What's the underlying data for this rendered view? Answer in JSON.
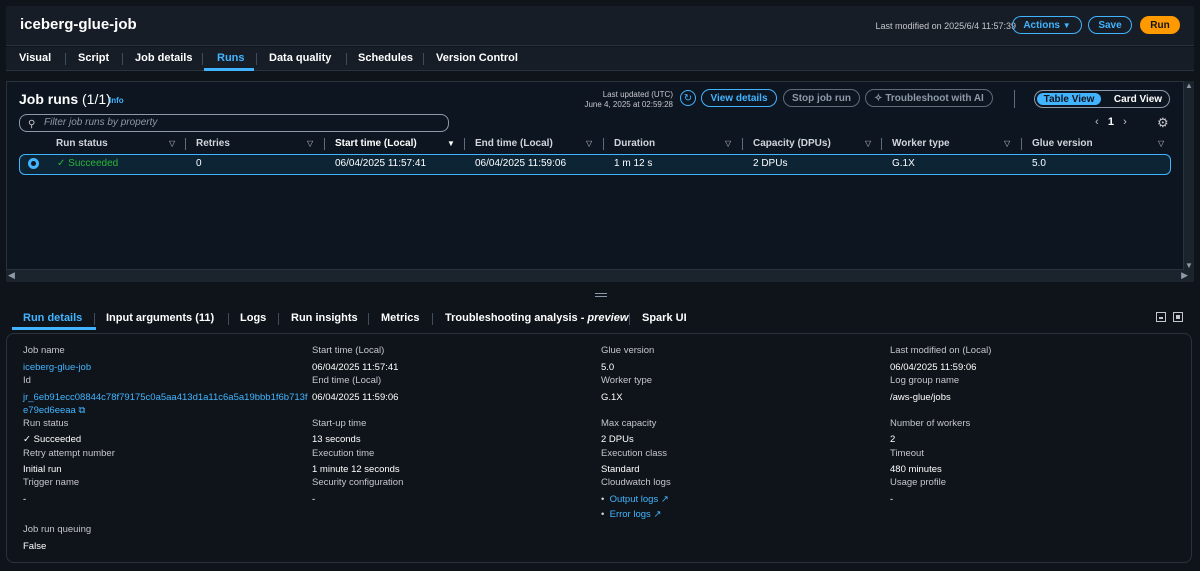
{
  "header": {
    "title": "iceberg-glue-job",
    "last_modified": "Last modified on 2025/6/4 11:57:39",
    "actions": "Actions",
    "save": "Save",
    "run": "Run"
  },
  "tabs": [
    "Visual",
    "Script",
    "Job details",
    "Runs",
    "Data quality",
    "Schedules",
    "Version Control"
  ],
  "runs_panel": {
    "title": "Job runs",
    "count": "(1/1)",
    "info": "Info",
    "last_updated_1": "Last updated (UTC)",
    "last_updated_2": "June 4, 2025 at 02:59:28",
    "view_details": "View details",
    "stop_job_run": "Stop job run",
    "troubleshoot": "Troubleshoot with AI",
    "table_view": "Table View",
    "card_view": "Card View",
    "filter_placeholder": "Filter job runs by property",
    "page": "1"
  },
  "table": {
    "columns": [
      "Run status",
      "Retries",
      "Start time (Local)",
      "End time (Local)",
      "Duration",
      "Capacity (DPUs)",
      "Worker type",
      "Glue version"
    ],
    "rows": [
      {
        "status": "Succeeded",
        "retries": "0",
        "start": "06/04/2025 11:57:41",
        "end": "06/04/2025 11:59:06",
        "duration": "1 m 12 s",
        "capacity": "2 DPUs",
        "worker": "G.1X",
        "glue": "5.0"
      }
    ]
  },
  "detail_tabs": [
    "Run details",
    "Input arguments (11)",
    "Logs",
    "Run insights",
    "Metrics",
    "Troubleshooting analysis - ",
    "preview",
    "Spark UI"
  ],
  "details": {
    "job_name_l": "Job name",
    "job_name": "iceberg-glue-job",
    "id_l": "Id",
    "id_1": "jr_6eb91ecc08844c78f79175c0a5aa413d1a11c6a5a19bbb1f6b713f",
    "id_2": "e79ed6eeaa",
    "run_status_l": "Run status",
    "run_status": "Succeeded",
    "retry_l": "Retry attempt number",
    "retry": "Initial run",
    "trigger_l": "Trigger name",
    "trigger": "-",
    "queue_l": "Job run queuing",
    "queue": "False",
    "start_l": "Start time (Local)",
    "start": "06/04/2025 11:57:41",
    "end_l": "End time (Local)",
    "end": "06/04/2025 11:59:06",
    "startup_l": "Start-up time",
    "startup": "13 seconds",
    "exec_l": "Execution time",
    "exec": "1 minute 12 seconds",
    "sec_l": "Security configuration",
    "sec": "-",
    "glue_l": "Glue version",
    "glue": "5.0",
    "worker_l": "Worker type",
    "worker": "G.1X",
    "maxcap_l": "Max capacity",
    "maxcap": "2 DPUs",
    "execclass_l": "Execution class",
    "execclass": "Standard",
    "cw_l": "Cloudwatch logs",
    "output_logs": "Output logs",
    "error_logs": "Error logs",
    "lastmod_l": "Last modified on (Local)",
    "lastmod": "06/04/2025 11:59:06",
    "loggroup_l": "Log group name",
    "loggroup": "/aws-glue/jobs",
    "workers_l": "Number of workers",
    "workers": "2",
    "timeout_l": "Timeout",
    "timeout": "480 minutes",
    "usage_l": "Usage profile",
    "usage": "-"
  },
  "colors": {
    "accent": "#42b4ff",
    "run_button": "#ff9900",
    "success": "#2bb534"
  }
}
